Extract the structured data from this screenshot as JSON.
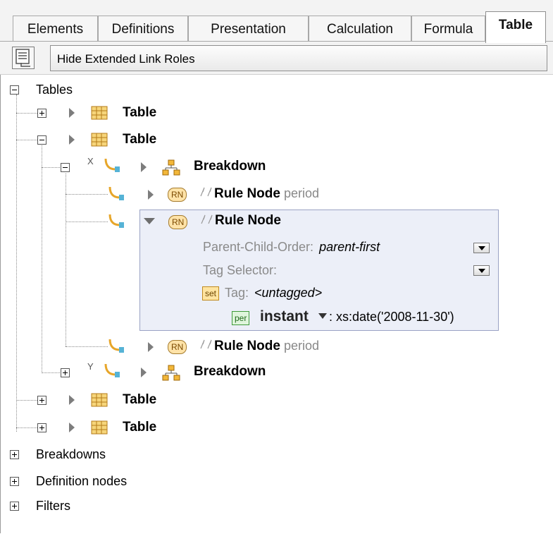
{
  "tabs": [
    {
      "label": "Elements"
    },
    {
      "label": "Definitions"
    },
    {
      "label": "Presentation"
    },
    {
      "label": "Calculation"
    },
    {
      "label": "Formula"
    },
    {
      "label": "Table"
    }
  ],
  "active_tab": "Table",
  "toolbar": {
    "button_label": "Hide Extended Link Roles"
  },
  "tree": {
    "tables_label": "Tables",
    "table_label": "Table",
    "breakdown_label": "Breakdown",
    "axis_x": "X",
    "axis_y": "Y",
    "rn_badge": "RN",
    "rule_node_label": "Rule Node",
    "period_label": "period",
    "breakdowns_label": "Breakdowns",
    "definition_nodes_label": "Definition nodes",
    "filters_label": "Filters"
  },
  "detail": {
    "parent_child_order_label": "Parent-Child-Order:",
    "parent_child_order_value": "parent-first",
    "tag_selector_label": "Tag Selector:",
    "set_badge": "set",
    "tag_label": "Tag:",
    "tag_value": "<untagged>",
    "per_badge": "per",
    "period_type": "instant",
    "period_value": ": xs:date('2008-11-30')"
  },
  "colors": {
    "detail_bg": "#eceff8",
    "rn_badge_bg": "#ffe3a8",
    "table_icon": "#d9a63a",
    "breakdown_icon": "#e39b1b"
  }
}
